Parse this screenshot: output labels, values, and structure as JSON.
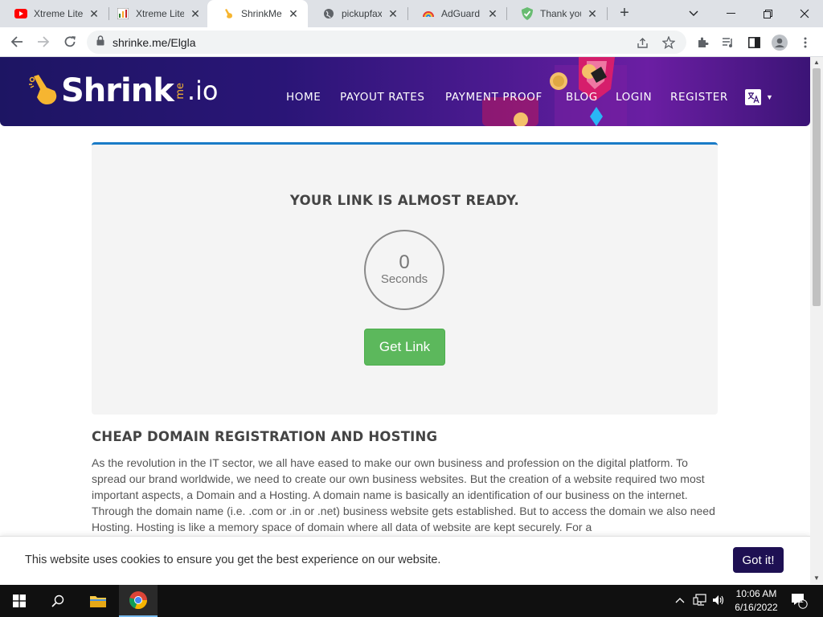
{
  "browser": {
    "tabs": [
      {
        "title": "Xtreme Lite",
        "icon": "youtube-icon",
        "active": false
      },
      {
        "title": "Xtreme Lite",
        "icon": "site-icon",
        "active": false
      },
      {
        "title": "ShrinkMe.i",
        "icon": "hand-icon",
        "active": true
      },
      {
        "title": "pickupfaxm",
        "icon": "globe-icon",
        "active": false
      },
      {
        "title": "AdGuard A",
        "icon": "rainbow-icon",
        "active": false
      },
      {
        "title": "Thank you",
        "icon": "shield-check-icon",
        "active": false
      }
    ],
    "close_glyph": "✕",
    "url": "shrinke.me/Elgla"
  },
  "site": {
    "logo": {
      "brand": "Shrink",
      "me": "me",
      "tld": ".io"
    },
    "menu": [
      {
        "label": "HOME"
      },
      {
        "label": "PAYOUT RATES"
      },
      {
        "label": "PAYMENT PROOF"
      },
      {
        "label": "BLOG"
      },
      {
        "label": "LOGIN"
      },
      {
        "label": "REGISTER"
      }
    ],
    "lang_icon": "translate-icon"
  },
  "card": {
    "title": "YOUR LINK IS ALMOST READY.",
    "countdown": "0",
    "countdown_label": "Seconds",
    "button": "Get Link"
  },
  "article": {
    "title": "CHEAP DOMAIN REGISTRATION AND HOSTING",
    "body": "As the revolution in the IT sector, we all have eased to make our own business and profession on the digital platform. To spread our brand worldwide, we need to create our own business websites. But the creation of a website required two most important aspects, a Domain and a Hosting. A domain name is basically an identification of our business on the internet. Through the domain name (i.e. .com or .in or .net) business website gets established. But to access the domain we also need Hosting. Hosting is like a memory space of domain where all data of website are kept securely. For a"
  },
  "cookie": {
    "message": "This website uses cookies to ensure you get the best experience on our website.",
    "button": "Got it!"
  },
  "taskbar": {
    "time": "10:06 AM",
    "date": "6/16/2022",
    "notifications": "1"
  },
  "colors": {
    "accent_blue": "#1a7bc7",
    "button_green": "#5cb85c",
    "cookie_button": "#1e1053",
    "header_purple": "#2a1577"
  }
}
